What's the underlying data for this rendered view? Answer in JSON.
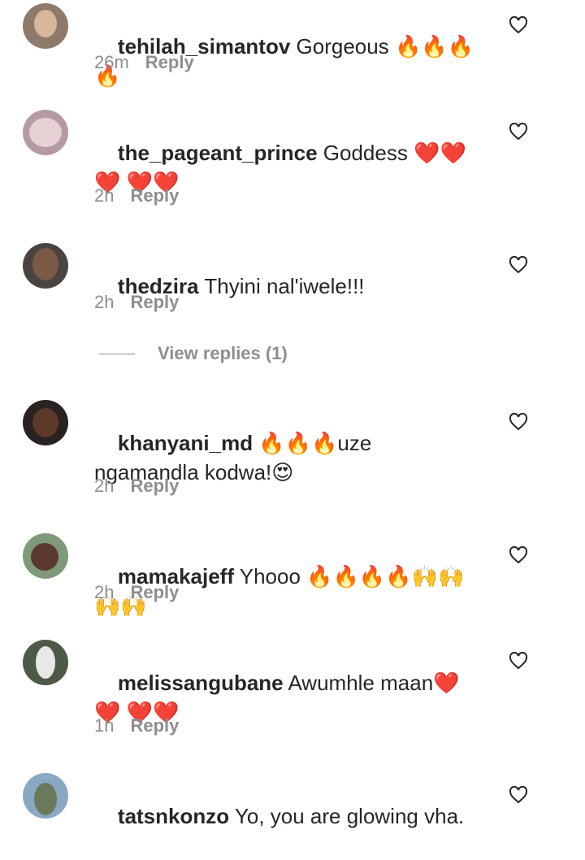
{
  "comments": [
    {
      "username": "tehilah_simantov",
      "text": "Gorgeous 🔥🔥🔥🔥",
      "time": "26m",
      "reply": "Reply"
    },
    {
      "username": "the_pageant_prince",
      "text": "Goddess ❤️❤️❤️ ❤️❤️",
      "time": "2h",
      "reply": "Reply"
    },
    {
      "username": "thedzira",
      "text": "Thyini nal'iwele!!!",
      "time": "2h",
      "reply": "Reply"
    },
    {
      "username": "khanyani_md",
      "text": "🔥🔥🔥uze ngamandla kodwa!😍",
      "time": "2h",
      "reply": "Reply"
    },
    {
      "username": "mamakajeff",
      "text": "Yhooo 🔥🔥🔥🔥🙌🙌🙌🙌",
      "time": "2h",
      "reply": "Reply"
    },
    {
      "username": "melissangubane",
      "text": "Awumhle maan❤️❤️ ❤️❤️",
      "time": "1h",
      "reply": "Reply"
    },
    {
      "username": "tatsnkonzo",
      "text": "Yo, you are glowing vha.",
      "time": "",
      "reply": ""
    }
  ],
  "view_replies": "View replies (1)",
  "icons": {
    "like": "heart-outline-icon",
    "avatar": "user-avatar"
  }
}
